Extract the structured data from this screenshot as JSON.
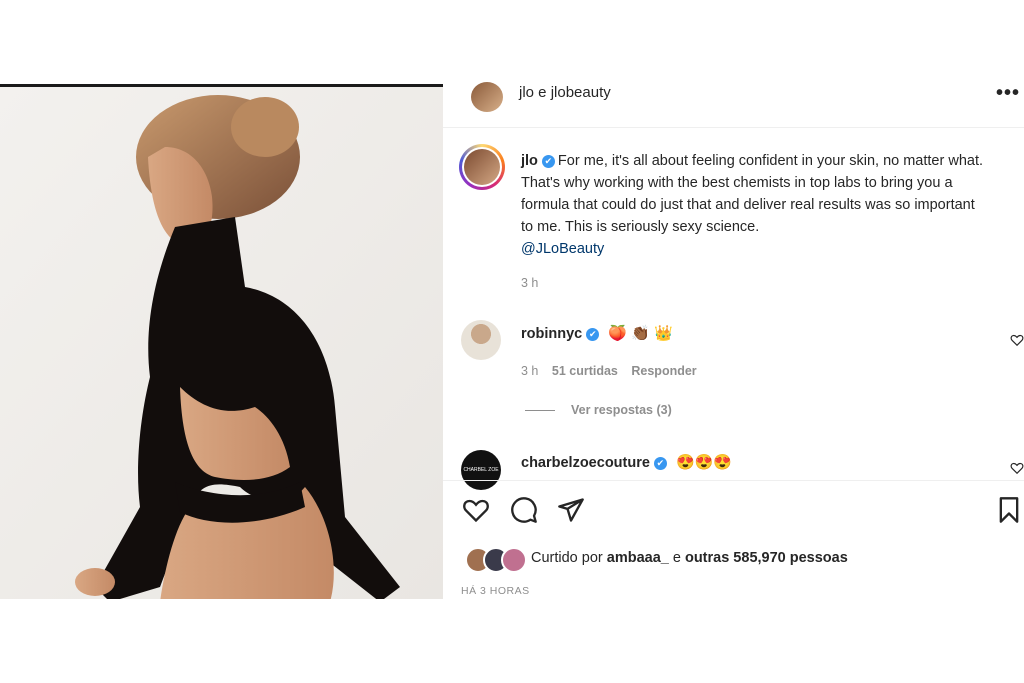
{
  "header": {
    "author": "jlo",
    "connector": " e ",
    "coauthor": "jlobeauty",
    "more_label": "•••"
  },
  "caption": {
    "username": "jlo",
    "verified": "✔",
    "text": "For me, it's all about feeling confident in your skin, no matter what. That's why working with the best chemists in top labs to bring you a formula that could do just that and deliver real results was so important to me. This is seriously sexy science.",
    "mention": "@JLoBeauty",
    "time": "3 h"
  },
  "comments": [
    {
      "username": "robinnyc",
      "verified": "✔",
      "emojis": "🍑 👏🏾 👑",
      "time": "3 h",
      "likes": "51 curtidas",
      "reply": "Responder",
      "view_replies": "Ver respostas (3)"
    },
    {
      "username": "charbelzoecouture",
      "verified": "✔",
      "emojis": "😍😍😍",
      "avatar_text": "CHARBEL ZOE"
    }
  ],
  "likes": {
    "prefix": "Curtido por ",
    "user": "ambaaa_",
    "middle": " e ",
    "others": "outras 585,970 pessoas"
  },
  "timestamp": "HÁ 3 HORAS",
  "colors": {
    "verified": "#3897f0",
    "mention": "#00376b",
    "muted": "#8e8e8e",
    "text": "#262626"
  },
  "icons": [
    "heart-icon",
    "comment-icon",
    "share-icon",
    "bookmark-icon",
    "more-icon",
    "verified-icon"
  ]
}
